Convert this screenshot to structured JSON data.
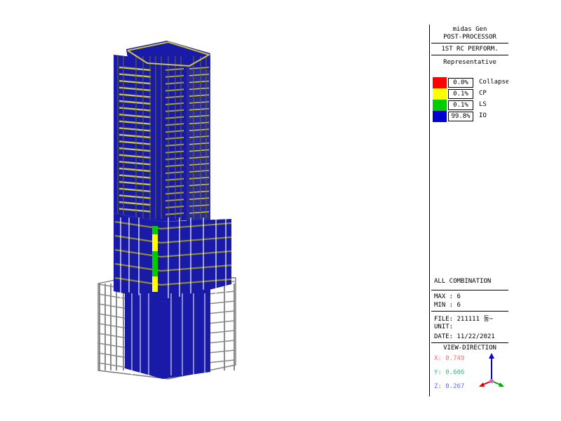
{
  "header": {
    "line1": "midas Gen",
    "line2": "POST-PROCESSOR",
    "result_type": "1ST RC PERFORM.",
    "mode": "Representative"
  },
  "legend": [
    {
      "percent": "0.0%",
      "label": "Collapse",
      "color": "#ff0000"
    },
    {
      "percent": "0.1%",
      "label": "CP",
      "color": "#ffff00"
    },
    {
      "percent": "0.1%",
      "label": "LS",
      "color": "#00cc00"
    },
    {
      "percent": "99.8%",
      "label": "IO",
      "color": "#0000cc"
    }
  ],
  "info": {
    "combination": "ALL COMBINATION",
    "max": "MAX : 6",
    "min": "MIN : 6",
    "file": "FILE: 211111 동~",
    "unit": "UNIT:",
    "date": "DATE: 11/22/2021"
  },
  "view": {
    "title": "VIEW-DIRECTION",
    "x": "X: 0.749",
    "y": "Y: 0.606",
    "z": "Z: 0.267",
    "x_color": "#ff6666",
    "y_color": "#33bb77",
    "z_color": "#6666ff"
  },
  "model_colors": {
    "io": "#1a1aa8",
    "frame": "#6b6b2a",
    "grey": "#8a8a8a",
    "cp": "#ffff00",
    "ls": "#00cc00"
  }
}
